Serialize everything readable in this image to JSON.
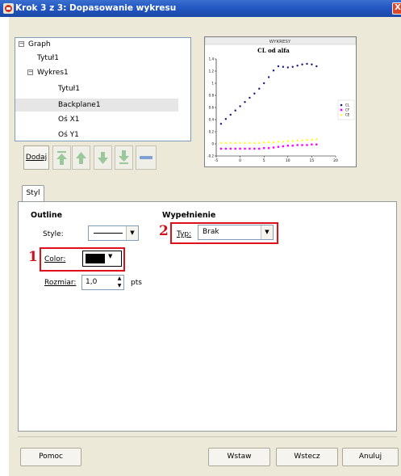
{
  "window": {
    "title": "Krok 3 z 3: Dopasowanie wykresu",
    "close_glyph": "X"
  },
  "tree": {
    "items": [
      {
        "label": "Graph",
        "expander": "−"
      },
      {
        "label": "Tytuł1"
      },
      {
        "label": "Wykres1",
        "expander": "−"
      },
      {
        "label": "Tytuł1"
      },
      {
        "label": "Backplane1",
        "selected": true
      },
      {
        "label": "Oś X1"
      },
      {
        "label": "Oś Y1"
      }
    ]
  },
  "toolbar": {
    "add_label": "Dodaj",
    "buttons": [
      "move-top-icon",
      "move-up-icon",
      "move-down-icon",
      "move-bottom-icon",
      "remove-icon"
    ]
  },
  "chart_data": {
    "type": "scatter",
    "header": "WYKRESY",
    "title": "CL od alfa",
    "xlim": [
      -5,
      20
    ],
    "ylim": [
      -0.2,
      1.4
    ],
    "xticks": [
      "-5",
      "0",
      "5",
      "10",
      "15",
      "20"
    ],
    "yticks": [
      "-0.2",
      "0",
      "0.2",
      "0.4",
      "0.6",
      "0.8",
      "1",
      "1.2",
      "1.4"
    ],
    "legend_position": "right",
    "series": [
      {
        "name": "CL",
        "color": "#1a1a80",
        "marker": "dot",
        "x": [
          -4,
          -3,
          -2,
          -1,
          0,
          1,
          2,
          3,
          4,
          5,
          6,
          7,
          8,
          9,
          10,
          11,
          12,
          13,
          14,
          15,
          16
        ],
        "y": [
          0.33,
          0.41,
          0.48,
          0.55,
          0.62,
          0.69,
          0.76,
          0.83,
          0.91,
          1.0,
          1.1,
          1.21,
          1.28,
          1.27,
          1.26,
          1.27,
          1.29,
          1.31,
          1.32,
          1.31,
          1.28
        ]
      },
      {
        "name": "CF",
        "color": "#ff00ff",
        "marker": "square",
        "x": [
          -4,
          -3,
          -2,
          -1,
          0,
          1,
          2,
          3,
          4,
          5,
          6,
          7,
          8,
          9,
          10,
          11,
          12,
          13,
          14,
          15,
          16
        ],
        "y": [
          -0.08,
          -0.08,
          -0.08,
          -0.08,
          -0.08,
          -0.08,
          -0.08,
          -0.08,
          -0.08,
          -0.07,
          -0.07,
          -0.06,
          -0.05,
          -0.04,
          -0.03,
          -0.03,
          -0.02,
          -0.02,
          -0.02,
          -0.01,
          -0.01
        ]
      },
      {
        "name": "CE",
        "color": "#ffff00",
        "marker": "triangle",
        "x": [
          -4,
          -3,
          -2,
          -1,
          0,
          1,
          2,
          3,
          4,
          5,
          6,
          7,
          8,
          9,
          10,
          11,
          12,
          13,
          14,
          15,
          16
        ],
        "y": [
          0.02,
          0.02,
          0.02,
          0.02,
          0.02,
          0.02,
          0.02,
          0.02,
          0.02,
          0.03,
          0.03,
          0.03,
          0.04,
          0.04,
          0.05,
          0.05,
          0.06,
          0.06,
          0.07,
          0.07,
          0.08
        ]
      }
    ]
  },
  "tabs": [
    {
      "label": "Styl"
    }
  ],
  "outline": {
    "heading": "Outline",
    "style_label": "Style:",
    "color_label": "Color:",
    "color_value": "#000000",
    "size_label": "Rozmiar:",
    "size_value": "1,0",
    "size_unit": "pts"
  },
  "fill": {
    "heading": "Wypełnienie",
    "type_label": "Typ:",
    "type_value": "Brak"
  },
  "annotations": {
    "marker_1": "1",
    "marker_2": "2"
  },
  "footer": {
    "help_label": "Pomoc",
    "insert_label": "Wstaw",
    "back_label": "Wstecz",
    "cancel_label": "Anuluj"
  }
}
